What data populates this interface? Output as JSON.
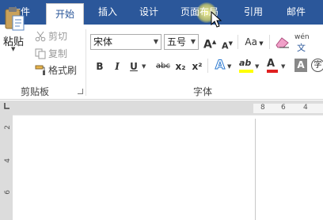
{
  "tabs": [
    {
      "label": "文件"
    },
    {
      "label": "开始"
    },
    {
      "label": "插入"
    },
    {
      "label": "设计"
    },
    {
      "label": "页面布局"
    },
    {
      "label": "引用"
    },
    {
      "label": "邮件"
    }
  ],
  "clipboard": {
    "paste_label": "粘贴",
    "cut_label": "剪切",
    "copy_label": "复制",
    "format_painter_label": "格式刷",
    "group_label": "剪贴板"
  },
  "font": {
    "font_name": "宋体",
    "font_size": "五号",
    "group_label": "字体",
    "wen_label": "wén",
    "wen_char": "文",
    "bold": "B",
    "italic": "I",
    "underline": "U",
    "strike": "abc",
    "subscript": "x₂",
    "superscript": "x²",
    "grow": "A",
    "shrink": "A",
    "case": "Aa",
    "text_effect": "A",
    "highlight": "ab",
    "font_color": "A",
    "char_shading": "A",
    "enclose": "字"
  },
  "ruler": {
    "h_ticks": [
      "8",
      "6",
      "4"
    ],
    "v_ticks": [
      "2",
      "4",
      "6"
    ]
  },
  "colors": {
    "accent": "#2b579a",
    "highlight_yellow": "#ffff00",
    "font_red": "#e02020"
  }
}
